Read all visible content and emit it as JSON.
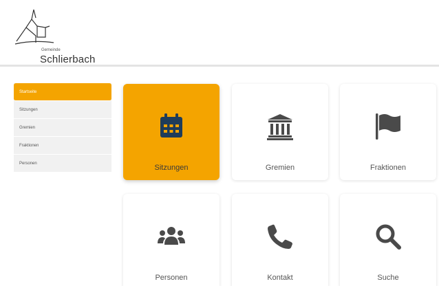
{
  "logo": {
    "small_text": "Gemeinde",
    "name": "Schlierbach"
  },
  "sidebar": {
    "items": [
      {
        "label": "Startseite",
        "active": true
      },
      {
        "label": "Sitzungen",
        "active": false
      },
      {
        "label": "Gremien",
        "active": false
      },
      {
        "label": "Fraktionen",
        "active": false
      },
      {
        "label": "Personen",
        "active": false
      }
    ]
  },
  "tiles": [
    {
      "label": "Sitzungen",
      "icon": "calendar-icon",
      "active": true
    },
    {
      "label": "Gremien",
      "icon": "institution-icon",
      "active": false
    },
    {
      "label": "Fraktionen",
      "icon": "flag-icon",
      "active": false
    },
    {
      "label": "Personen",
      "icon": "users-icon",
      "active": false
    },
    {
      "label": "Kontakt",
      "icon": "phone-icon",
      "active": false
    },
    {
      "label": "Suche",
      "icon": "search-icon",
      "active": false
    }
  ],
  "colors": {
    "accent": "#f4a400",
    "icon_dark": "#4a4a4a",
    "icon_active": "#1f3c5a"
  }
}
